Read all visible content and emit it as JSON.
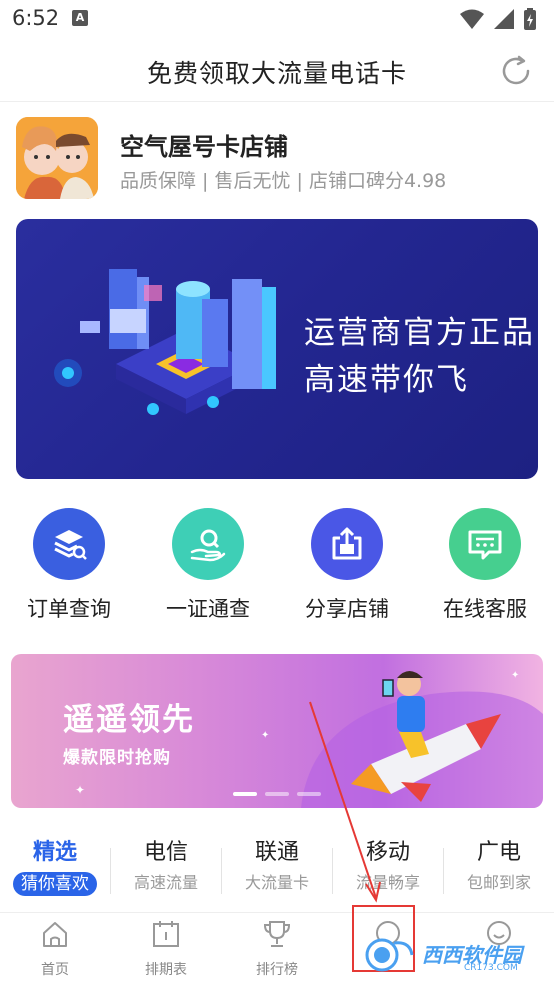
{
  "status_bar": {
    "time": "6:52",
    "notification_icon": "A"
  },
  "header": {
    "title": "免费领取大流量电话卡"
  },
  "shop": {
    "name": "空气屋号卡店铺",
    "tagline": "品质保障 | 售后无忧 | 店铺口碑分4.98"
  },
  "banner": {
    "line1": "运营商官方正品",
    "line2": "高速带你飞"
  },
  "actions": [
    {
      "label": "订单查询",
      "icon": "layers-search-icon",
      "color": "#3a5fe0"
    },
    {
      "label": "一证通查",
      "icon": "hand-search-icon",
      "color": "#3ecfb6"
    },
    {
      "label": "分享店铺",
      "icon": "share-box-icon",
      "color": "#4a57e6"
    },
    {
      "label": "在线客服",
      "icon": "chat-bubble-icon",
      "color": "#46cf8f"
    }
  ],
  "promo": {
    "title": "遥遥领先",
    "subtitle": "爆款限时抢购"
  },
  "tabs": [
    {
      "name": "精选",
      "sub": "猜你喜欢",
      "active": true
    },
    {
      "name": "电信",
      "sub": "高速流量"
    },
    {
      "name": "联通",
      "sub": "大流量卡"
    },
    {
      "name": "移动",
      "sub": "流量畅享"
    },
    {
      "name": "广电",
      "sub": "包邮到家"
    }
  ],
  "bottom_nav": [
    {
      "label": "首页",
      "icon": "home-icon"
    },
    {
      "label": "排期表",
      "icon": "calendar-icon"
    },
    {
      "label": "排行榜",
      "icon": "trophy-icon"
    },
    {
      "label": "",
      "icon": "chat-icon"
    },
    {
      "label": "",
      "icon": "user-icon"
    }
  ],
  "watermark": {
    "text": "西西软件园",
    "sub": "CR173.COM"
  },
  "colors": {
    "accent": "#2a64e8",
    "banner_bg": "#2a2e9e",
    "highlight": "#e53935"
  }
}
